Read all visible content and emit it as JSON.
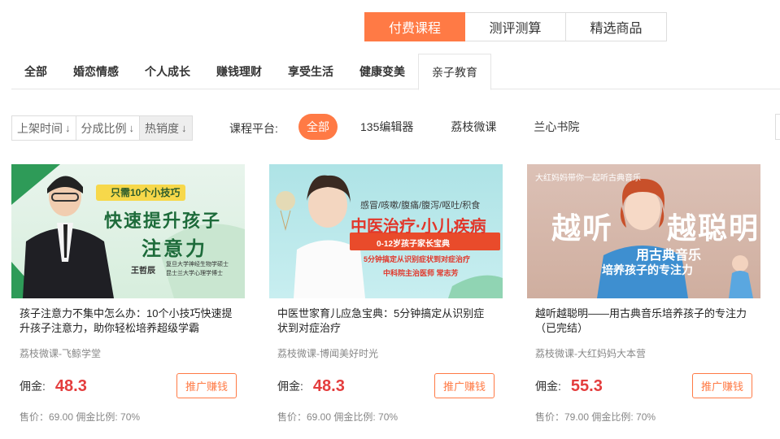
{
  "top_tabs": [
    "付费课程",
    "测评测算",
    "精选商品"
  ],
  "categories": [
    "全部",
    "婚恋情感",
    "个人成长",
    "赚钱理财",
    "享受生活",
    "健康变美",
    "亲子教育"
  ],
  "sort": [
    "上架时间",
    "分成比例",
    "热销度"
  ],
  "platform": {
    "label": "课程平台:",
    "options": [
      "全部",
      "135编辑器",
      "荔枝微课",
      "兰心书院"
    ]
  },
  "commission_label": "佣金:",
  "promote_label": "推广赚钱",
  "products": [
    {
      "title": "孩子注意力不集中怎么办：10个小技巧快速提升孩子注意力，助你轻松培养超级学霸",
      "source": "荔枝微课-飞鲸学堂",
      "commission": "48.3",
      "sale": "售价：69.00 佣金比例: 70%",
      "img": {
        "tag": "只需10个小技巧",
        "line1": "快速提升孩子",
        "line2": "注意力",
        "name": "王哲辰",
        "cred1": "复旦大学神经生物学硕士",
        "cred2": "昆士兰大学心理学博士"
      }
    },
    {
      "title": "中医世家育儿应急宝典：5分钟搞定从识别症状到对症治疗",
      "source": "荔枝微课-博闻美好时光",
      "commission": "48.3",
      "sale": "售价：69.00 佣金比例: 70%",
      "img": {
        "symptoms": "感冒/咳嗽/腹痛/腹泻/呕吐/积食",
        "headline": "中医治疗·小儿疾病",
        "band": "0-12岁孩子家长宝典",
        "sub": "5分钟搞定从识别症状到对症治疗",
        "doctor": "中科院主治医师 常志芳"
      }
    },
    {
      "title": "越听越聪明——用古典音乐培养孩子的专注力（已完结）",
      "source": "荔枝微课-大红妈妈大本营",
      "commission": "55.3",
      "sale": "售价：79.00 佣金比例: 70%",
      "img": {
        "top": "大红妈妈带你一起听古典音乐",
        "big_left": "越听",
        "big_right": "越聪明",
        "sub1": "用古典音乐",
        "sub2": "培养孩子的专注力"
      }
    }
  ],
  "colors": {
    "accent": "#ff7a45",
    "price": "#e43d3d"
  }
}
